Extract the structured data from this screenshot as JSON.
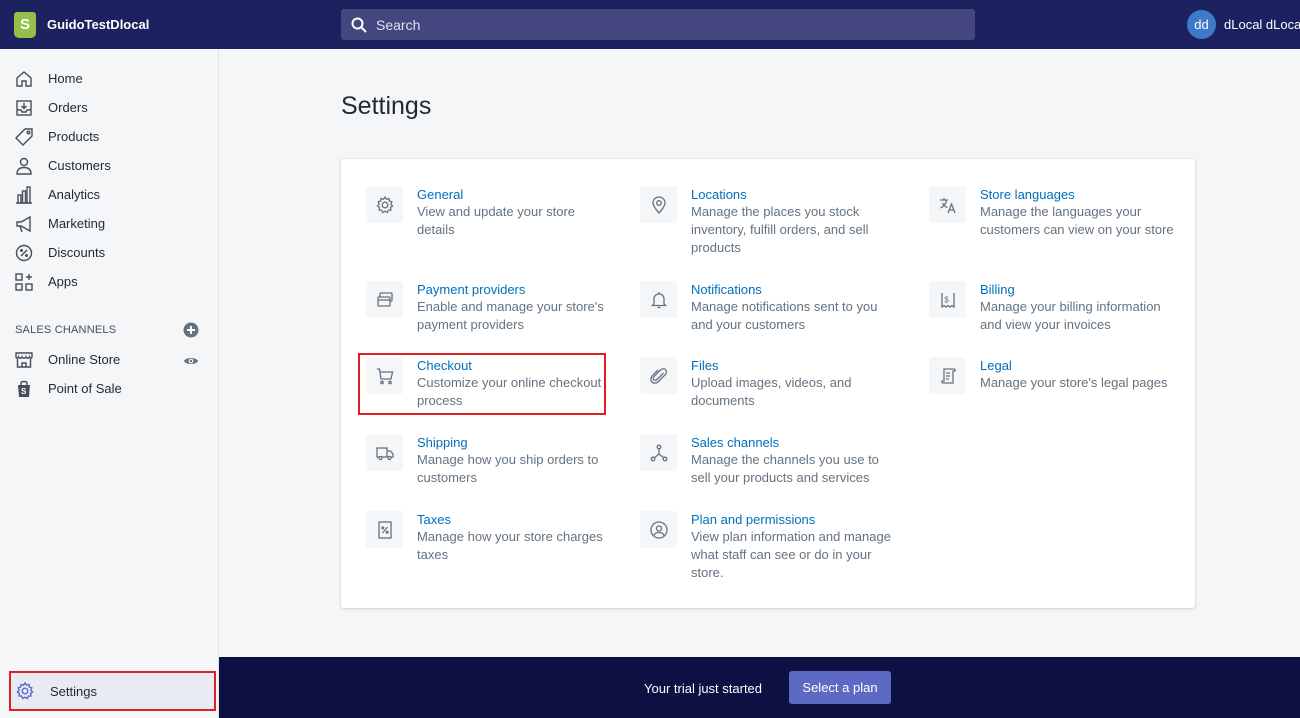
{
  "topbar": {
    "store_name": "GuidoTestDlocal",
    "logo_letter": "S",
    "search_placeholder": "Search",
    "avatar_initials": "dd",
    "user_name": "dLocal dLocal"
  },
  "sidebar": {
    "items": [
      {
        "label": "Home",
        "icon": "home-icon"
      },
      {
        "label": "Orders",
        "icon": "orders-icon"
      },
      {
        "label": "Products",
        "icon": "tag-icon"
      },
      {
        "label": "Customers",
        "icon": "customer-icon"
      },
      {
        "label": "Analytics",
        "icon": "analytics-icon"
      },
      {
        "label": "Marketing",
        "icon": "megaphone-icon"
      },
      {
        "label": "Discounts",
        "icon": "discount-icon"
      },
      {
        "label": "Apps",
        "icon": "apps-icon"
      }
    ],
    "sales_channels_title": "SALES CHANNELS",
    "channels": [
      {
        "label": "Online Store",
        "icon": "store-icon"
      },
      {
        "label": "Point of Sale",
        "icon": "pos-bag-icon"
      }
    ],
    "settings_label": "Settings"
  },
  "main": {
    "title": "Settings",
    "settings": [
      {
        "title": "General",
        "desc": [
          "View and update your store",
          "details"
        ],
        "icon": "gear-icon"
      },
      {
        "title": "Locations",
        "desc": [
          "Manage the places you stock",
          "inventory, fulfill orders, and sell",
          "products"
        ],
        "icon": "location-pin-icon"
      },
      {
        "title": "Store languages",
        "desc": [
          "Manage the languages your",
          "customers can view on your store"
        ],
        "icon": "translate-icon"
      },
      {
        "title": "Payment providers",
        "desc": [
          "Enable and manage your store's",
          "payment providers"
        ],
        "icon": "payment-icon"
      },
      {
        "title": "Notifications",
        "desc": [
          "Manage notifications sent to you",
          "and your customers"
        ],
        "icon": "bell-icon"
      },
      {
        "title": "Billing",
        "desc": [
          "Manage your billing information",
          "and view your invoices"
        ],
        "icon": "billing-icon"
      },
      {
        "title": "Checkout",
        "desc": [
          "Customize your online checkout",
          "process"
        ],
        "icon": "cart-icon"
      },
      {
        "title": "Files",
        "desc": [
          "Upload images, videos, and",
          "documents"
        ],
        "icon": "paperclip-icon"
      },
      {
        "title": "Legal",
        "desc": [
          "Manage your store's legal pages"
        ],
        "icon": "legal-icon"
      },
      {
        "title": "Shipping",
        "desc": [
          "Manage how you ship orders to",
          "customers"
        ],
        "icon": "truck-icon"
      },
      {
        "title": "Sales channels",
        "desc": [
          "Manage the channels you use to",
          "sell your products and services"
        ],
        "icon": "channels-icon"
      },
      {
        "title": "Taxes",
        "desc": [
          "Manage how your store charges",
          "taxes"
        ],
        "icon": "tax-icon"
      },
      {
        "title": "Plan and permissions",
        "desc": [
          "View plan information and manage",
          "what staff can see or do in your",
          "store."
        ],
        "icon": "user-circle-icon"
      }
    ]
  },
  "trial": {
    "text": "Your trial just started",
    "button_label": "Select a plan"
  },
  "colors": {
    "topbar": "#1c2260",
    "link": "#006fbb",
    "highlight": "#e02020",
    "trial_bg": "#0d1042",
    "button": "#5c6ac4"
  }
}
